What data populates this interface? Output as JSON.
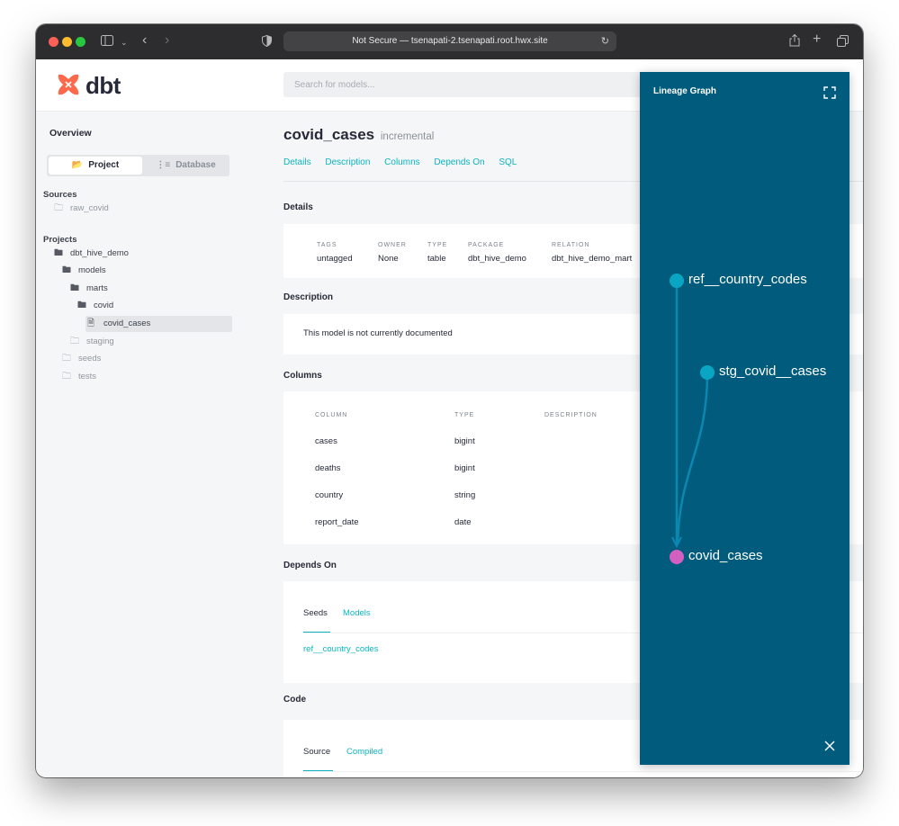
{
  "browser": {
    "url_text": "Not Secure — tsenapati-2.tsenapati.root.hwx.site"
  },
  "header": {
    "logo_text": "dbt",
    "search_placeholder": "Search for models..."
  },
  "sidebar": {
    "overview": "Overview",
    "project_tab": "Project",
    "database_tab": "Database",
    "sources_heading": "Sources",
    "sources": [
      "raw_covid"
    ],
    "projects_heading": "Projects",
    "tree": {
      "project": "dbt_hive_demo",
      "models": "models",
      "marts": "marts",
      "covid": "covid",
      "covid_cases": "covid_cases",
      "staging": "staging",
      "seeds": "seeds",
      "tests": "tests"
    }
  },
  "main": {
    "title": "covid_cases",
    "materialization": "incremental",
    "tabs": [
      "Details",
      "Description",
      "Columns",
      "Depends On",
      "SQL"
    ],
    "details": {
      "heading": "Details",
      "fields": [
        {
          "label": "TAGS",
          "value": "untagged"
        },
        {
          "label": "OWNER",
          "value": "None"
        },
        {
          "label": "TYPE",
          "value": "table"
        },
        {
          "label": "PACKAGE",
          "value": "dbt_hive_demo"
        },
        {
          "label": "RELATION",
          "value": "dbt_hive_demo_mart"
        }
      ]
    },
    "description": {
      "heading": "Description",
      "text": "This model is not currently documented"
    },
    "columns": {
      "heading": "Columns",
      "headers": [
        "COLUMN",
        "TYPE",
        "DESCRIPTION"
      ],
      "rows": [
        {
          "name": "cases",
          "type": "bigint"
        },
        {
          "name": "deaths",
          "type": "bigint"
        },
        {
          "name": "country",
          "type": "string"
        },
        {
          "name": "report_date",
          "type": "date"
        }
      ]
    },
    "depends_on": {
      "heading": "Depends On",
      "tabs": [
        "Seeds",
        "Models"
      ],
      "items": [
        "ref__country_codes"
      ]
    },
    "code": {
      "heading": "Code",
      "tabs": [
        "Source",
        "Compiled"
      ]
    }
  },
  "lineage": {
    "title": "Lineage Graph",
    "nodes": [
      "ref__country_codes",
      "stg_covid__cases",
      "covid_cases"
    ],
    "colors": {
      "background": "#005b7c",
      "node": "#0ba5c4",
      "current_node": "#d35fc1"
    }
  }
}
